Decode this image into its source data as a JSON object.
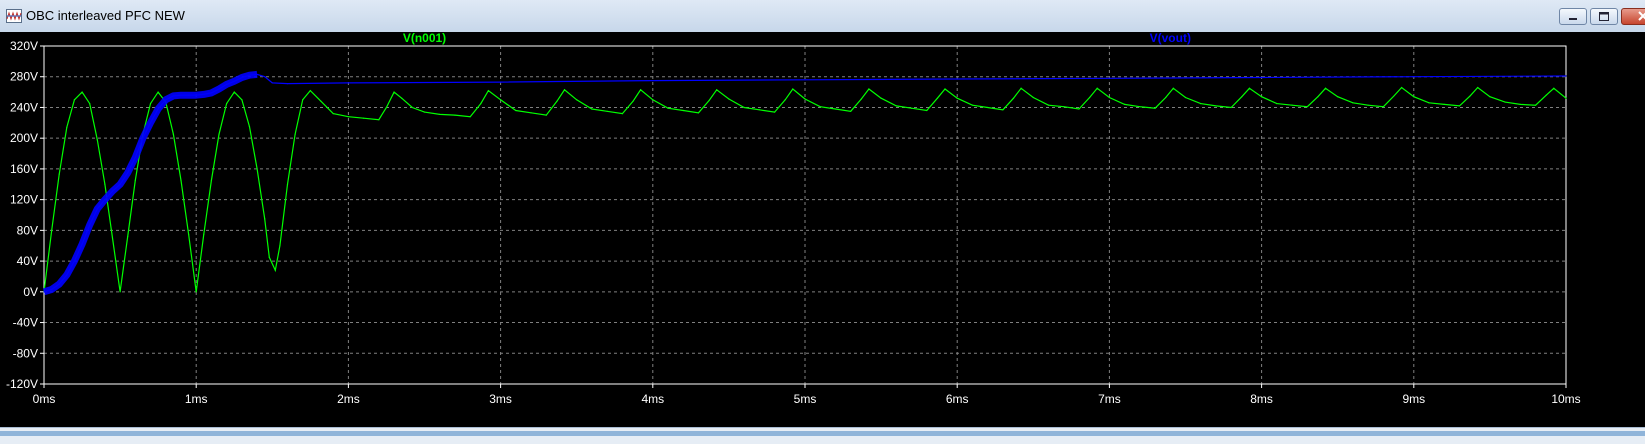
{
  "window": {
    "title": "OBC interleaved PFC NEW",
    "icon": "waveform-app-icon",
    "buttons": [
      "minimize",
      "maximize",
      "close"
    ]
  },
  "plot": {
    "background": "#000000",
    "grid_color": "#808080",
    "axis_color": "#ffffff",
    "traces": [
      {
        "name": "V(n001)",
        "color": "#00ff00"
      },
      {
        "name": "V(vout)",
        "color": "#0000ff"
      }
    ],
    "y_ticks": [
      "320V",
      "280V",
      "240V",
      "200V",
      "160V",
      "120V",
      "80V",
      "40V",
      "0V",
      "-40V",
      "-80V",
      "-120V"
    ],
    "x_ticks": [
      "0ms",
      "1ms",
      "2ms",
      "3ms",
      "4ms",
      "5ms",
      "6ms",
      "7ms",
      "8ms",
      "9ms",
      "10ms"
    ]
  },
  "chart_data": {
    "type": "line",
    "title": "",
    "xlabel": "",
    "ylabel": "",
    "x_unit": "ms",
    "y_unit": "V",
    "xlim": [
      0,
      10
    ],
    "ylim": [
      -120,
      320
    ],
    "grid": true,
    "series": [
      {
        "name": "V(n001)",
        "color": "#00ff00",
        "x": [
          0,
          0.05,
          0.1,
          0.15,
          0.2,
          0.25,
          0.3,
          0.35,
          0.4,
          0.45,
          0.5,
          0.55,
          0.6,
          0.65,
          0.7,
          0.75,
          0.8,
          0.85,
          0.9,
          0.95,
          1.0,
          1.05,
          1.1,
          1.15,
          1.2,
          1.25,
          1.3,
          1.35,
          1.4,
          1.45,
          1.48,
          1.52,
          1.55,
          1.6,
          1.65,
          1.7,
          1.75,
          1.82,
          1.9,
          2.0,
          2.1,
          2.2,
          2.25,
          2.3,
          2.35,
          2.42,
          2.5,
          2.6,
          2.7,
          2.8,
          2.87,
          2.92,
          3.0,
          3.1,
          3.2,
          3.3,
          3.37,
          3.42,
          3.5,
          3.6,
          3.7,
          3.8,
          3.87,
          3.92,
          4.0,
          4.1,
          4.2,
          4.3,
          4.37,
          4.42,
          4.5,
          4.6,
          4.7,
          4.8,
          4.87,
          4.92,
          5.0,
          5.1,
          5.2,
          5.3,
          5.37,
          5.42,
          5.5,
          5.6,
          5.7,
          5.8,
          5.87,
          5.92,
          6.0,
          6.1,
          6.2,
          6.3,
          6.37,
          6.42,
          6.5,
          6.6,
          6.7,
          6.8,
          6.87,
          6.92,
          7.0,
          7.1,
          7.2,
          7.3,
          7.37,
          7.42,
          7.5,
          7.6,
          7.7,
          7.8,
          7.87,
          7.92,
          8.0,
          8.1,
          8.2,
          8.3,
          8.37,
          8.42,
          8.5,
          8.6,
          8.7,
          8.8,
          8.87,
          8.92,
          9.0,
          9.1,
          9.2,
          9.3,
          9.37,
          9.42,
          9.5,
          9.6,
          9.7,
          9.8,
          9.87,
          9.92,
          10.0
        ],
        "y": [
          0,
          79,
          153,
          214,
          250,
          260,
          245,
          198,
          140,
          70,
          0,
          72,
          145,
          205,
          245,
          260,
          247,
          205,
          145,
          75,
          0,
          75,
          145,
          205,
          245,
          260,
          250,
          215,
          160,
          95,
          45,
          28,
          60,
          140,
          205,
          250,
          262,
          248,
          232,
          228,
          226,
          224,
          240,
          260,
          252,
          240,
          234,
          231,
          230,
          228,
          245,
          262,
          250,
          236,
          233,
          230,
          248,
          263,
          250,
          238,
          235,
          232,
          248,
          263,
          250,
          239,
          236,
          233,
          249,
          263,
          251,
          240,
          237,
          234,
          250,
          264,
          251,
          241,
          238,
          235,
          251,
          264,
          252,
          242,
          239,
          236,
          252,
          264,
          252,
          243,
          240,
          237,
          252,
          265,
          253,
          243,
          241,
          238,
          253,
          265,
          253,
          244,
          241,
          239,
          253,
          265,
          253,
          245,
          242,
          240,
          254,
          265,
          254,
          245,
          243,
          241,
          254,
          265,
          254,
          246,
          243,
          241,
          255,
          266,
          254,
          246,
          244,
          242,
          255,
          266,
          254,
          247,
          244,
          243,
          256,
          265,
          252
        ]
      },
      {
        "name": "V(vout)",
        "color": "#0000ff",
        "x": [
          0,
          0.05,
          0.1,
          0.15,
          0.2,
          0.25,
          0.3,
          0.35,
          0.4,
          0.45,
          0.5,
          0.55,
          0.6,
          0.65,
          0.7,
          0.75,
          0.8,
          0.85,
          0.9,
          0.95,
          1.0,
          1.05,
          1.1,
          1.15,
          1.2,
          1.25,
          1.3,
          1.35,
          1.4,
          1.45,
          1.5,
          1.6,
          2.0,
          3.0,
          4.0,
          5.0,
          6.0,
          7.0,
          8.0,
          9.0,
          10.0
        ],
        "y": [
          0,
          3,
          10,
          22,
          40,
          62,
          87,
          108,
          120,
          131,
          140,
          155,
          175,
          200,
          220,
          238,
          250,
          255,
          256,
          256,
          256,
          257,
          259,
          264,
          270,
          274,
          279,
          282,
          283,
          280,
          272,
          271,
          272,
          273,
          275,
          276,
          277,
          278,
          279,
          280,
          281
        ]
      }
    ]
  }
}
